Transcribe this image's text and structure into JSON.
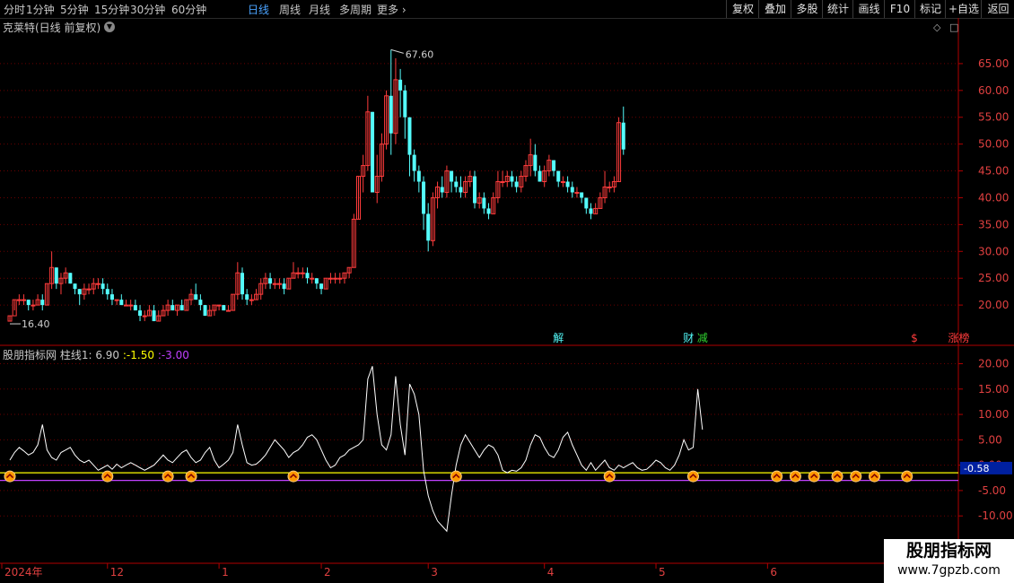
{
  "toolbar": {
    "periods": [
      "分时",
      "1分钟",
      "5分钟",
      "15分钟",
      "30分钟",
      "60分钟",
      "日线",
      "周线",
      "月线",
      "多周期",
      "更多"
    ],
    "active_period": "日线",
    "right_buttons": [
      "复权",
      "叠加",
      "多股",
      "统计",
      "画线",
      "F10",
      "标记",
      "+自选",
      "返回"
    ]
  },
  "stock": {
    "title": "克莱特(日线 前复权)"
  },
  "colors": {
    "up": "#ff3c3c",
    "down": "#54fcfc",
    "axis": "#b00000",
    "ind_line": "#ffffff",
    "ind_level_1": "#ffff00",
    "ind_level_2": "#c040ff",
    "marker": "#ff9900"
  },
  "indicator": {
    "name": "股朋指标网",
    "field1_label": "柱线1",
    "field1_value": "6.90",
    "field2": ":-1.50",
    "field3": ":-3.00",
    "current_value": "-0.58"
  },
  "annotations": {
    "high_label": "67.60",
    "low_label": "16.40",
    "event_labels": [
      "解",
      "财",
      "减",
      "$",
      "涨榜"
    ]
  },
  "watermark": {
    "title": "股朋指标网",
    "url": "www.7gpzb.com"
  },
  "chart_data": {
    "type": "candlestick",
    "price_axis": {
      "ticks": [
        20,
        25,
        30,
        35,
        40,
        45,
        50,
        55,
        60,
        65
      ],
      "labels": [
        "20.00",
        "25.00",
        "30.00",
        "35.00",
        "40.00",
        "45.00",
        "50.00",
        "55.00",
        "60.00",
        "65.00"
      ],
      "range": [
        14.0,
        69.5
      ]
    },
    "indicator_axis": {
      "ticks": [
        -10,
        -5,
        0,
        5,
        10,
        15,
        20
      ],
      "labels": [
        "-10.00",
        "-5.00",
        "0.00",
        "5.00",
        "10.00",
        "15.00",
        "20.00"
      ],
      "range": [
        -13.5,
        21.5
      ],
      "levels": [
        -1.5,
        -3.0
      ]
    },
    "x_labels": [
      "2024年",
      "12",
      "1",
      "2",
      "3",
      "4",
      "5",
      "6"
    ],
    "x_label_index": [
      0,
      21,
      45,
      67,
      90,
      115,
      139,
      163
    ],
    "candles": [
      [
        17,
        18,
        17,
        18
      ],
      [
        18,
        21,
        19,
        21
      ],
      [
        21,
        22,
        20,
        21
      ],
      [
        21,
        22,
        20,
        21
      ],
      [
        21,
        21,
        19,
        20
      ],
      [
        20,
        21,
        19,
        20
      ],
      [
        20,
        22,
        20,
        21
      ],
      [
        21,
        22,
        19,
        20
      ],
      [
        20,
        24,
        20,
        24
      ],
      [
        24,
        30,
        23,
        27
      ],
      [
        27,
        27,
        23,
        24
      ],
      [
        24,
        26,
        22,
        25
      ],
      [
        25,
        27,
        24,
        26
      ],
      [
        26,
        26,
        24,
        24
      ],
      [
        24,
        24,
        22,
        23
      ],
      [
        23,
        23,
        20,
        22
      ],
      [
        22,
        24,
        21,
        23
      ],
      [
        23,
        24,
        22,
        23
      ],
      [
        23,
        25,
        22,
        24
      ],
      [
        24,
        25,
        23,
        24
      ],
      [
        24,
        25,
        22,
        23
      ],
      [
        23,
        24,
        21,
        22
      ],
      [
        22,
        23,
        20,
        21
      ],
      [
        21,
        21,
        20,
        21
      ],
      [
        21,
        22,
        20,
        20
      ],
      [
        20,
        21,
        20,
        20
      ],
      [
        20,
        21,
        19,
        20
      ],
      [
        20,
        21,
        19,
        19
      ],
      [
        19,
        20,
        17,
        18
      ],
      [
        18,
        19,
        17,
        18
      ],
      [
        18,
        20,
        18,
        19
      ],
      [
        19,
        20,
        17,
        17
      ],
      [
        17,
        19,
        17,
        18
      ],
      [
        18,
        20,
        18,
        19
      ],
      [
        19,
        21,
        18,
        20
      ],
      [
        20,
        21,
        19,
        19
      ],
      [
        19,
        20,
        18,
        20
      ],
      [
        20,
        21,
        19,
        19
      ],
      [
        19,
        21,
        19,
        21
      ],
      [
        21,
        23,
        20,
        22
      ],
      [
        22,
        24,
        21,
        21
      ],
      [
        21,
        22,
        19,
        20
      ],
      [
        20,
        20,
        18,
        18
      ],
      [
        18,
        20,
        18,
        19
      ],
      [
        19,
        20,
        18,
        20
      ],
      [
        20,
        20,
        19,
        20
      ],
      [
        20,
        20,
        19,
        19
      ],
      [
        19,
        20,
        19,
        19
      ],
      [
        19,
        22,
        19,
        22
      ],
      [
        22,
        28,
        21,
        26
      ],
      [
        26,
        27,
        21,
        22
      ],
      [
        22,
        23,
        20,
        21
      ],
      [
        21,
        22,
        20,
        21
      ],
      [
        21,
        23,
        21,
        22
      ],
      [
        22,
        25,
        21,
        24
      ],
      [
        24,
        26,
        23,
        25
      ],
      [
        25,
        26,
        23,
        24
      ],
      [
        24,
        25,
        23,
        24
      ],
      [
        24,
        25,
        23,
        24
      ],
      [
        24,
        25,
        22,
        23
      ],
      [
        23,
        25,
        23,
        25
      ],
      [
        25,
        28,
        25,
        26
      ],
      [
        26,
        27,
        25,
        26
      ],
      [
        26,
        27,
        25,
        26
      ],
      [
        26,
        27,
        24,
        25
      ],
      [
        25,
        26,
        24,
        25
      ],
      [
        25,
        25,
        23,
        24
      ],
      [
        24,
        24,
        22,
        23
      ],
      [
        23,
        25,
        23,
        25
      ],
      [
        25,
        26,
        24,
        25
      ],
      [
        25,
        26,
        24,
        25
      ],
      [
        25,
        26,
        24,
        25
      ],
      [
        25,
        26,
        24,
        26
      ],
      [
        26,
        27,
        25,
        27
      ],
      [
        27,
        37,
        27,
        36
      ],
      [
        36,
        44,
        36,
        44
      ],
      [
        44,
        48,
        41,
        46
      ],
      [
        46,
        59,
        45,
        56
      ],
      [
        56,
        56,
        41,
        41
      ],
      [
        41,
        48,
        39,
        44
      ],
      [
        44,
        52,
        43,
        50
      ],
      [
        50,
        60,
        49,
        59
      ],
      [
        59,
        67.6,
        48,
        52
      ],
      [
        52,
        66,
        50,
        62
      ],
      [
        62,
        64,
        55,
        60
      ],
      [
        60,
        61,
        51,
        55
      ],
      [
        55,
        55,
        44,
        48
      ],
      [
        48,
        49,
        43,
        45
      ],
      [
        45,
        46,
        41,
        43
      ],
      [
        43,
        44,
        34,
        37
      ],
      [
        37,
        39,
        30,
        32
      ],
      [
        32,
        41,
        31,
        40
      ],
      [
        40,
        43,
        38,
        42
      ],
      [
        42,
        44,
        40,
        41
      ],
      [
        41,
        46,
        40,
        45
      ],
      [
        45,
        45,
        41,
        43
      ],
      [
        43,
        44,
        41,
        42
      ],
      [
        42,
        44,
        40,
        41
      ],
      [
        41,
        44,
        40,
        43
      ],
      [
        43,
        45,
        42,
        44
      ],
      [
        44,
        45,
        38,
        39
      ],
      [
        39,
        41,
        38,
        40
      ],
      [
        40,
        41,
        37,
        38
      ],
      [
        38,
        39,
        36,
        37
      ],
      [
        37,
        41,
        37,
        40
      ],
      [
        40,
        45,
        39,
        43
      ],
      [
        43,
        45,
        42,
        43
      ],
      [
        43,
        45,
        42,
        44
      ],
      [
        44,
        45,
        42,
        43
      ],
      [
        43,
        44,
        41,
        42
      ],
      [
        42,
        45,
        41,
        44
      ],
      [
        44,
        47,
        43,
        46
      ],
      [
        46,
        51,
        44,
        48
      ],
      [
        48,
        50,
        44,
        45
      ],
      [
        45,
        46,
        43,
        43
      ],
      [
        43,
        46,
        42,
        45
      ],
      [
        45,
        48,
        44,
        47
      ],
      [
        47,
        47,
        44,
        45
      ],
      [
        45,
        45,
        42,
        43
      ],
      [
        43,
        44,
        42,
        43
      ],
      [
        43,
        44,
        41,
        42
      ],
      [
        42,
        43,
        40,
        41
      ],
      [
        41,
        42,
        40,
        41
      ],
      [
        41,
        41,
        39,
        40
      ],
      [
        40,
        40,
        37,
        38
      ],
      [
        38,
        39,
        36,
        37
      ],
      [
        37,
        39,
        37,
        38
      ],
      [
        38,
        41,
        38,
        40
      ],
      [
        40,
        45,
        39,
        42
      ],
      [
        42,
        43,
        41,
        42
      ],
      [
        42,
        44,
        41,
        43
      ],
      [
        43,
        55,
        43,
        54
      ],
      [
        54,
        57,
        48,
        49
      ]
    ],
    "indicator": [
      1.0,
      2.5,
      3.5,
      2.8,
      2.0,
      2.5,
      4.0,
      8.0,
      3.0,
      1.5,
      1.0,
      2.5,
      3.0,
      3.5,
      2.0,
      1.0,
      0.5,
      1.0,
      0.0,
      -1.0,
      -0.5,
      0.0,
      -0.8,
      0.2,
      -0.5,
      0.0,
      0.5,
      0.0,
      -0.5,
      -1.0,
      -0.5,
      0.0,
      1.0,
      2.0,
      1.0,
      0.5,
      1.5,
      2.5,
      3.0,
      1.5,
      0.5,
      1.0,
      2.5,
      3.5,
      1.0,
      -0.5,
      0.2,
      1.0,
      2.5,
      8.0,
      4.0,
      0.5,
      0.0,
      0.2,
      1.0,
      2.0,
      3.5,
      5.0,
      4.0,
      3.0,
      1.5,
      2.5,
      3.0,
      4.0,
      5.5,
      6.0,
      5.0,
      3.0,
      1.0,
      -0.5,
      0.0,
      1.5,
      2.0,
      3.0,
      3.5,
      4.0,
      5.0,
      17.0,
      19.5,
      10.0,
      4.0,
      3.0,
      6.0,
      17.5,
      8.0,
      2.0,
      16.0,
      14.0,
      10.0,
      -1.0,
      -6.0,
      -9.0,
      -11.0,
      -12.0,
      -13.0,
      -6.0,
      0.0,
      4.0,
      6.0,
      4.5,
      3.0,
      1.5,
      3.0,
      4.0,
      3.5,
      2.0,
      -1.0,
      -1.5,
      -1.0,
      -1.2,
      -0.5,
      1.0,
      4.0,
      6.0,
      5.5,
      3.5,
      2.0,
      1.5,
      3.0,
      5.5,
      6.5,
      4.0,
      2.0,
      0.0,
      -1.0,
      0.5,
      -1.0,
      0.0,
      1.0,
      -0.5,
      -1.0,
      0.0,
      -0.5,
      0.0,
      0.5,
      -0.5,
      -1.0,
      -0.8,
      0.0,
      1.0,
      0.5,
      -0.5,
      -1.0,
      0.0,
      2.0,
      5.0,
      3.0,
      3.5,
      15.0,
      7.0
    ],
    "signals": [
      0,
      21,
      34,
      39,
      61,
      96,
      129,
      147,
      165,
      169,
      173,
      178,
      182,
      186,
      193
    ]
  }
}
